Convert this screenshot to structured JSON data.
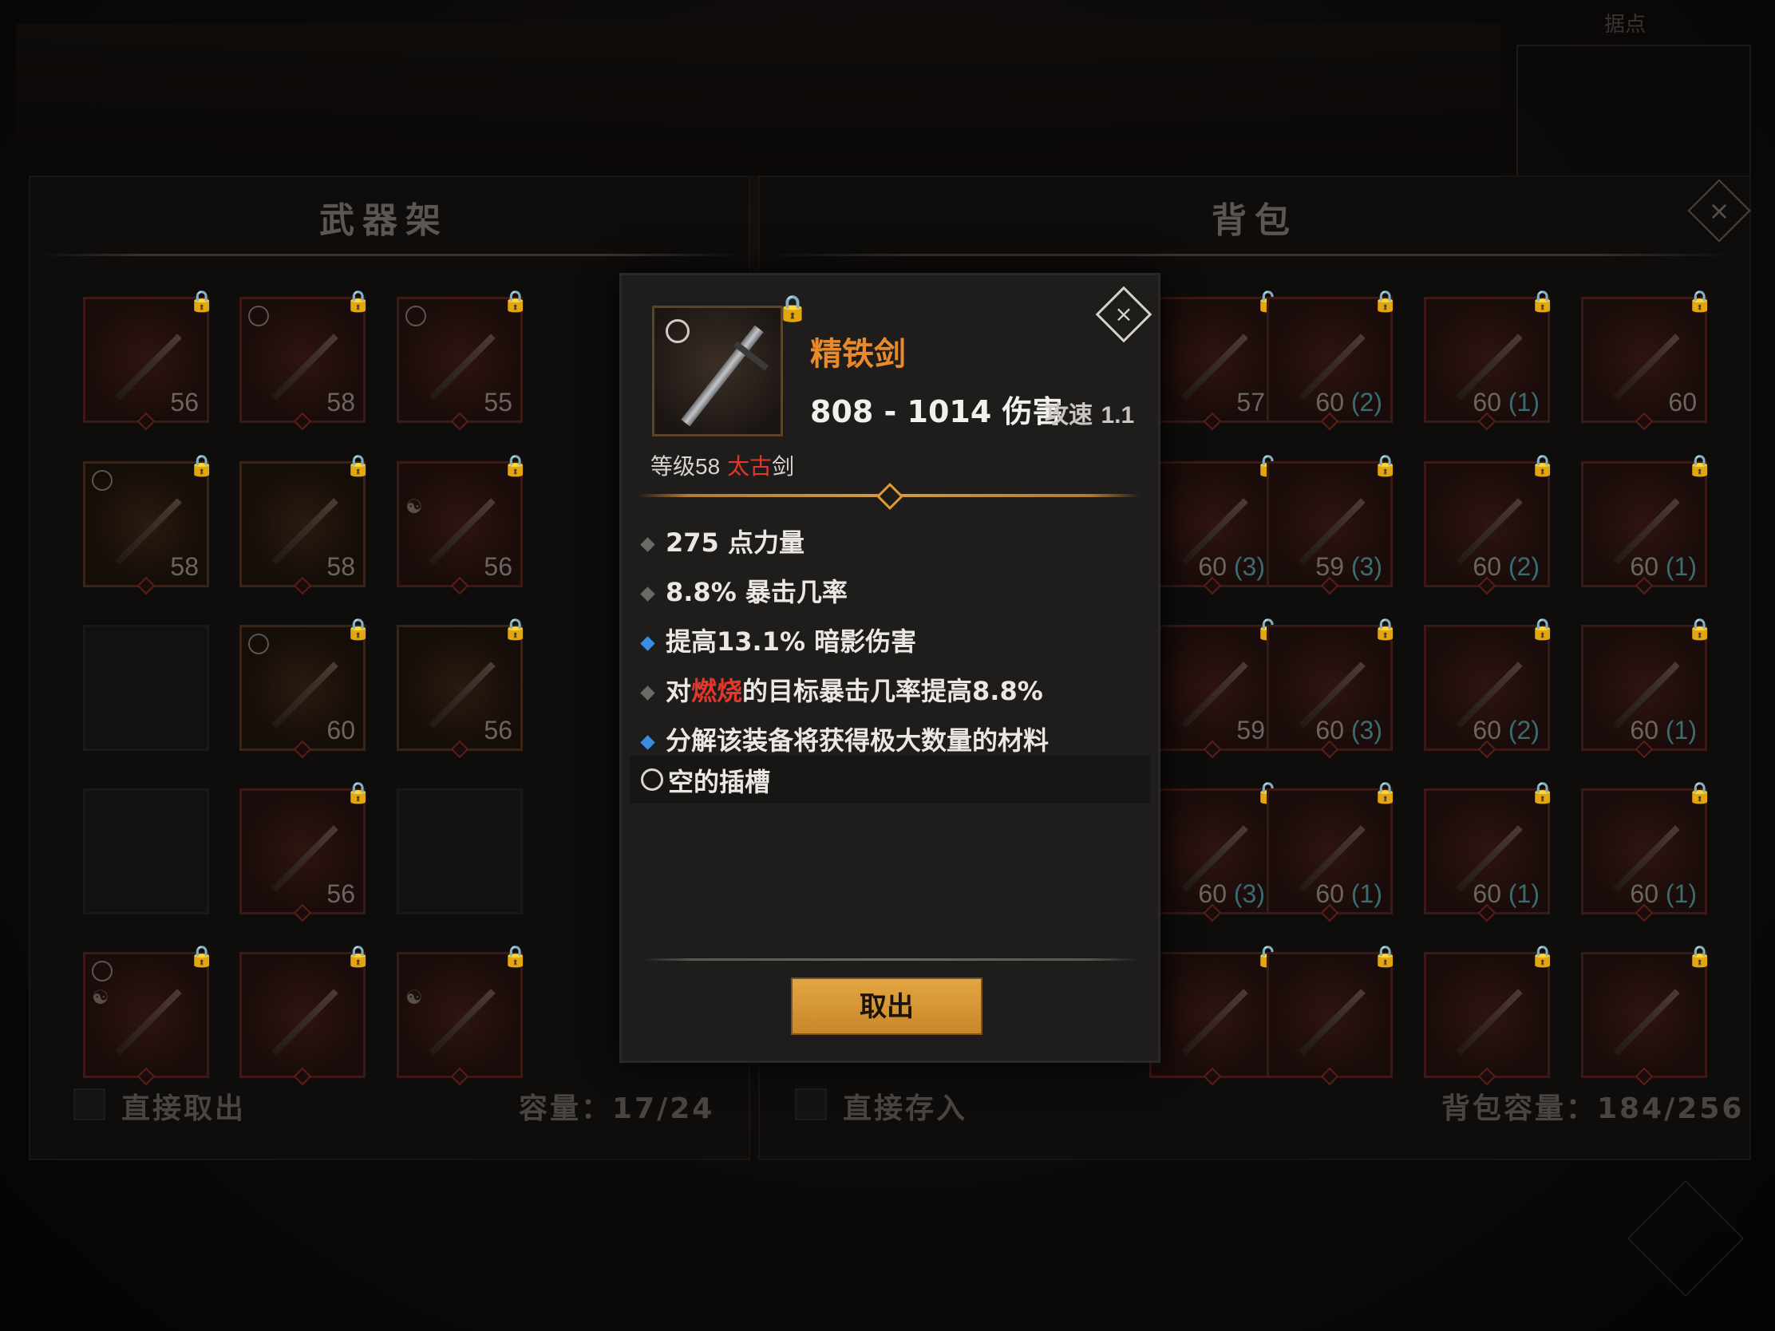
{
  "header": {
    "minimap_label": "据点"
  },
  "weapon_rack": {
    "title": "武器架",
    "direct_label": "直接取出",
    "capacity_label": "容量：17/24",
    "slots": [
      {
        "level": "56",
        "count": "",
        "circle": false,
        "yinyang": false,
        "type": "red"
      },
      {
        "level": "58",
        "count": "",
        "circle": true,
        "yinyang": false,
        "type": "red"
      },
      {
        "level": "55",
        "count": "",
        "circle": true,
        "yinyang": false,
        "type": "red"
      },
      {
        "level": "58",
        "count": "",
        "circle": true,
        "yinyang": false,
        "type": "brown"
      },
      {
        "level": "58",
        "count": "",
        "circle": false,
        "yinyang": false,
        "type": "brown"
      },
      {
        "level": "56",
        "count": "",
        "circle": false,
        "yinyang": true,
        "type": "red"
      },
      {
        "level": "",
        "count": "",
        "circle": false,
        "yinyang": false,
        "type": "empty"
      },
      {
        "level": "60",
        "count": "",
        "circle": true,
        "yinyang": false,
        "type": "brown"
      },
      {
        "level": "56",
        "count": "",
        "circle": false,
        "yinyang": false,
        "type": "brown"
      },
      {
        "level": "",
        "count": "",
        "circle": false,
        "yinyang": false,
        "type": "empty"
      },
      {
        "level": "56",
        "count": "",
        "circle": false,
        "yinyang": false,
        "type": "red"
      },
      {
        "level": "",
        "count": "",
        "circle": false,
        "yinyang": false,
        "type": "empty"
      },
      {
        "level": "",
        "count": "",
        "circle": true,
        "yinyang": true,
        "type": "red"
      },
      {
        "level": "",
        "count": "",
        "circle": false,
        "yinyang": false,
        "type": "red"
      },
      {
        "level": "",
        "count": "",
        "circle": false,
        "yinyang": true,
        "type": "red"
      }
    ]
  },
  "backpack": {
    "title": "背包",
    "direct_label": "直接存入",
    "capacity_label": "背包容量：184/256",
    "slots": [
      {
        "level": "57",
        "count": ""
      },
      {
        "level": "60",
        "count": "(2)"
      },
      {
        "level": "60",
        "count": "(1)"
      },
      {
        "level": "60",
        "count": ""
      },
      {
        "level": "60",
        "count": "(3)"
      },
      {
        "level": "59",
        "count": "(3)"
      },
      {
        "level": "60",
        "count": "(2)"
      },
      {
        "level": "60",
        "count": "(1)"
      },
      {
        "level": "59",
        "count": ""
      },
      {
        "level": "60",
        "count": "(3)"
      },
      {
        "level": "60",
        "count": "(2)"
      },
      {
        "level": "60",
        "count": "(1)"
      },
      {
        "level": "60",
        "count": "(3)"
      },
      {
        "level": "60",
        "count": "(1)"
      },
      {
        "level": "60",
        "count": "(1)"
      },
      {
        "level": "60",
        "count": "(1)"
      },
      {
        "level": "",
        "count": ""
      },
      {
        "level": "",
        "count": ""
      },
      {
        "level": "",
        "count": ""
      },
      {
        "level": "",
        "count": ""
      }
    ]
  },
  "tooltip": {
    "name": "精铁剑",
    "damage": "808 - 1014 伤害",
    "speed_label": "攻速",
    "speed_value": "1.1",
    "level_prefix": "等级",
    "level_value": "58",
    "category_red": "太古",
    "category_rest": "剑",
    "stats": [
      {
        "text": "275 点力量",
        "blue": false
      },
      {
        "text": "8.8% 暴击几率",
        "blue": false
      },
      {
        "text": "提高13.1% 暗影伤害",
        "blue": true
      }
    ],
    "stat_burn_prefix": "对",
    "stat_burn_red": "燃烧",
    "stat_burn_rest": "的目标暴击几率提高8.8%",
    "stat_disassemble": "分解该装备将获得极大数量的材料",
    "socket_label": "空的插槽",
    "take_button": "取出",
    "close_symbol": "×"
  },
  "colors": {
    "accent": "#e88a2c",
    "button": "#d69a38",
    "blue_bullet": "#3b8de0",
    "red_text": "#e2372c",
    "lock": "#f0c419"
  }
}
